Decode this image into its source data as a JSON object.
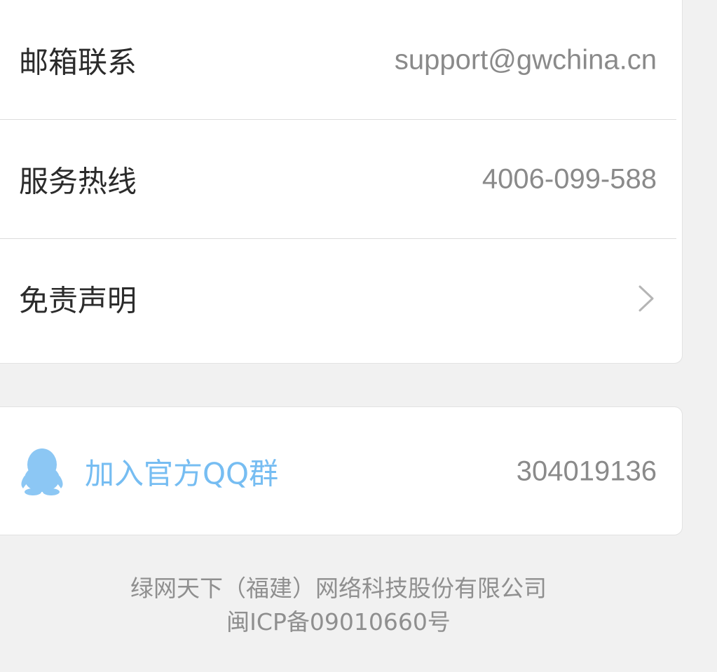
{
  "contact": {
    "rows": [
      {
        "label": "邮箱联系",
        "value": "support@gwchina.cn"
      },
      {
        "label": "服务热线",
        "value": "4006-099-588"
      },
      {
        "label": "免责声明",
        "icon": "chevron-right-icon"
      }
    ]
  },
  "qq": {
    "icon": "qq-penguin-icon",
    "label": "加入官方QQ群",
    "number": "304019136"
  },
  "footer": {
    "company": "绿网天下（福建）网络科技股份有限公司",
    "icp": "闽ICP备09010660号"
  },
  "colors": {
    "background": "#f1f1f1",
    "card": "#ffffff",
    "label_text": "#2b2b2b",
    "value_text": "#8a8a8a",
    "accent_blue": "#76bdf2"
  }
}
